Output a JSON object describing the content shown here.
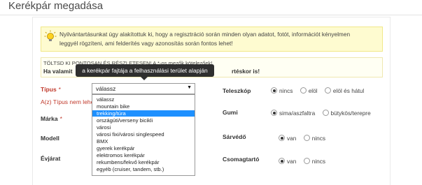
{
  "page": {
    "title": "Kerékpár megadása"
  },
  "notice": {
    "text": "Nyilvántartásunkat úgy alakítottuk ki, hogy a regisztráció során minden olyan adatot, fotót, információt kényelmen leggyél rögzíteni, ami felderítés vagy azonosítás során fontos lehet!",
    "icon": "lightbulb-icon"
  },
  "warning": {
    "line1": "TÖLTSD KI PONTOSAN ÉS RÉSZLETESEN! A *-os mezők kötelezőek!",
    "line2_start": "Ha valamit",
    "line2_end": "rtéskor is!"
  },
  "tooltip": {
    "text": "a kerékpár fajtája a felhasználási terület alapján"
  },
  "form": {
    "tipus": {
      "label": "Típus",
      "required": "*",
      "selected": "válassz",
      "error": "A(z) Típus nem lehe",
      "options": [
        "válassz",
        "mountain bike",
        "trekking/túra",
        "országúti/verseny bicikli",
        "városi",
        "városi fixi/városi singlespeed",
        "BMX",
        "gyerek kerékpár",
        "elektromos kerékpár",
        "rekumbens/fekvő kerékpár",
        "egyéb (cruiser, tandem, stb.)"
      ],
      "highlighted_index": 2
    },
    "marka": {
      "label": "Márka",
      "required": "*"
    },
    "modell": {
      "label": "Modell"
    },
    "evjarat": {
      "label": "Évjárat"
    },
    "teleszkop": {
      "label": "Teleszkóp",
      "options": [
        "nincs",
        "elöl",
        "elöl és hátul"
      ],
      "selected": 0
    },
    "gumi": {
      "label": "Gumi",
      "options": [
        "sima/aszfaltra",
        "bütykös/terepre"
      ],
      "selected": 0
    },
    "sarvedo": {
      "label": "Sárvédő",
      "options": [
        "van",
        "nincs"
      ],
      "selected": 0
    },
    "csomagtarto": {
      "label": "Csomagtartó",
      "options": [
        "van",
        "nincs"
      ],
      "selected": 0
    }
  }
}
